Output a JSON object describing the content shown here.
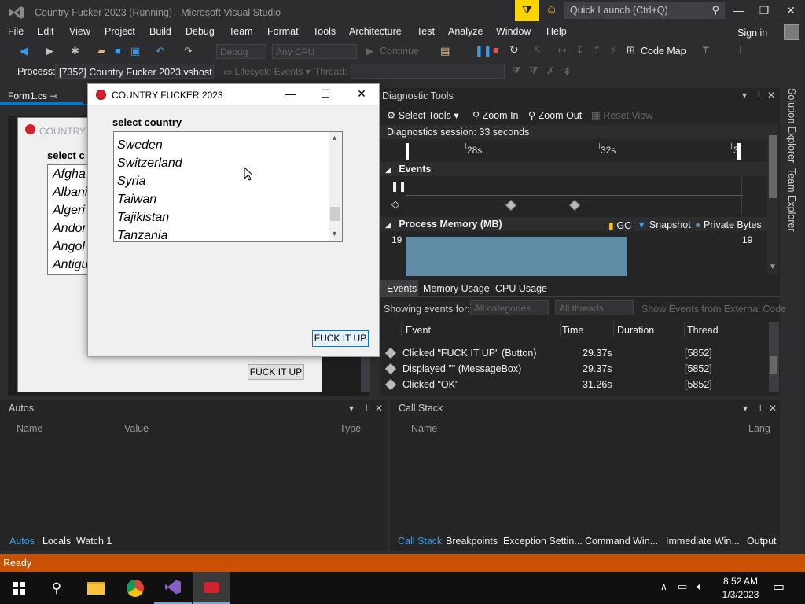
{
  "window": {
    "title": "Country Fucker 2023 (Running) - Microsoft Visual Studio",
    "quick_launch_placeholder": "Quick Launch (Ctrl+Q)"
  },
  "menu": [
    "File",
    "Edit",
    "View",
    "Project",
    "Build",
    "Debug",
    "Team",
    "Format",
    "Tools",
    "Architecture",
    "Test",
    "Analyze",
    "Window",
    "Help"
  ],
  "sign_in": "Sign in",
  "toolbar": {
    "config": "Debug",
    "platform": "Any CPU",
    "continue": "Continue",
    "code_map": "Code Map"
  },
  "debug_location": {
    "process_label": "Process:",
    "process_value": "[7352] Country Fucker 2023.vshost",
    "lifecycle": "Lifecycle Events",
    "thread_label": "Thread:"
  },
  "document_tab": "Form1.cs",
  "designer_form": {
    "title": "COUNTRY F",
    "label": "select c",
    "items": [
      "Afgha",
      "Albani",
      "Algeri",
      "Andor",
      "Angol",
      "Antigu"
    ],
    "button": "FUCK IT UP"
  },
  "app": {
    "title": "COUNTRY FUCKER 2023",
    "label": "select country",
    "countries": [
      "Sweden",
      "Switzerland",
      "Syria",
      "Taiwan",
      "Tajikistan",
      "Tanzania"
    ],
    "button": "FUCK IT UP"
  },
  "diagnostics": {
    "title": "Diagnostic Tools",
    "select_tools": "Select Tools",
    "zoom_in": "Zoom In",
    "zoom_out": "Zoom Out",
    "reset_view": "Reset View",
    "session": "Diagnostics session: 33 seconds",
    "tick_28": "28s",
    "tick_32": "32s",
    "tick_3": "3",
    "events_header": "Events",
    "memory_header": "Process Memory (MB)",
    "legend_gc": "GC",
    "legend_snapshot": "Snapshot",
    "legend_private": "Private Bytes",
    "mem_max": "19",
    "tabs": [
      "Events",
      "Memory Usage",
      "CPU Usage"
    ],
    "showing_label": "Showing events for:",
    "filter_categories": "All categories",
    "filter_threads": "All threads",
    "external_code": "Show Events from External Code",
    "columns": [
      "Event",
      "Time",
      "Duration",
      "Thread"
    ],
    "rows": [
      {
        "event": "Clicked \"FUCK IT UP\" (Button)",
        "time": "29.37s",
        "duration": "",
        "thread": "[5852]"
      },
      {
        "event": "Displayed \"\" (MessageBox)",
        "time": "29.37s",
        "duration": "",
        "thread": "[5852]"
      },
      {
        "event": "Clicked \"OK\"",
        "time": "31.26s",
        "duration": "",
        "thread": "[5852]"
      }
    ]
  },
  "autos": {
    "title": "Autos",
    "columns": [
      "Name",
      "Value",
      "Type"
    ],
    "tabs": [
      "Autos",
      "Locals",
      "Watch 1"
    ]
  },
  "callstack": {
    "title": "Call Stack",
    "columns": [
      "Name",
      "Lang"
    ],
    "tabs": [
      "Call Stack",
      "Breakpoints",
      "Exception Settin...",
      "Command Win...",
      "Immediate Win...",
      "Output"
    ]
  },
  "side_tabs": [
    "Solution Explorer",
    "Team Explorer"
  ],
  "status": "Ready",
  "clock": {
    "time": "8:52 AM",
    "date": "1/3/2023"
  },
  "colors": {
    "accent": "#007acc",
    "status_bar": "#ca5100",
    "memory_fill": "#5f8ca7"
  }
}
